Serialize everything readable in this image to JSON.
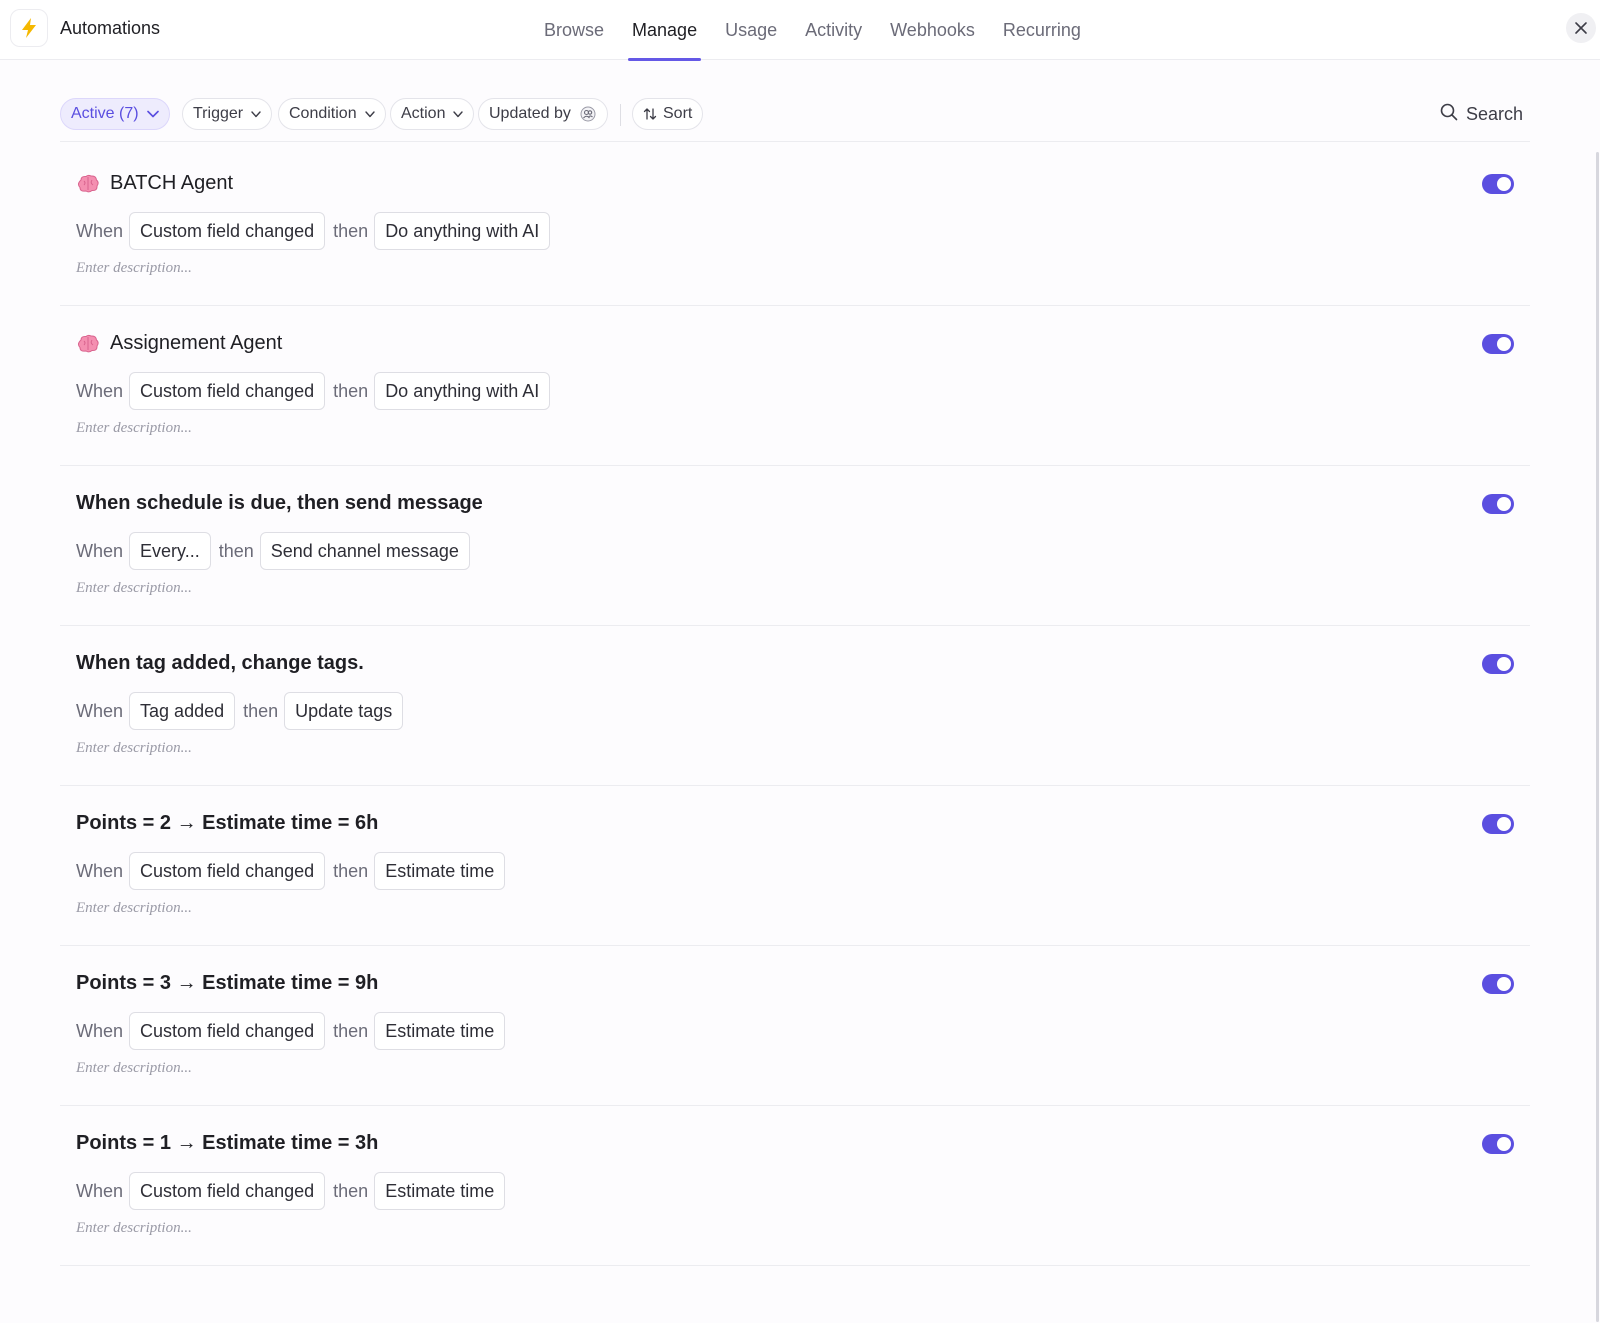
{
  "header": {
    "title": "Automations",
    "tabs": [
      {
        "label": "Browse"
      },
      {
        "label": "Manage"
      },
      {
        "label": "Usage"
      },
      {
        "label": "Activity"
      },
      {
        "label": "Webhooks"
      },
      {
        "label": "Recurring"
      }
    ],
    "active_tab": "Manage"
  },
  "filters": {
    "active": "Active (7)",
    "trigger": "Trigger",
    "condition": "Condition",
    "action": "Action",
    "updated_by": "Updated by",
    "sort": "Sort",
    "search": "Search"
  },
  "colors": {
    "accent": "#5b4fe0",
    "brand_bolt": "#f5b800"
  },
  "automations": [
    {
      "title": "BATCH Agent",
      "icon": "brain-icon",
      "when": "When",
      "trigger": "Custom field changed",
      "then": "then",
      "action": "Do anything with AI",
      "description_placeholder": "Enter description...",
      "enabled": true
    },
    {
      "title": "Assignement Agent",
      "icon": "brain-icon",
      "when": "When",
      "trigger": "Custom field changed",
      "then": "then",
      "action": "Do anything with AI",
      "description_placeholder": "Enter description...",
      "enabled": true
    },
    {
      "title": "When schedule is due, then send message",
      "when": "When",
      "trigger": "Every...",
      "then": "then",
      "action": "Send channel message",
      "description_placeholder": "Enter description...",
      "enabled": true
    },
    {
      "title": "When tag added, change tags.",
      "when": "When",
      "trigger": "Tag added",
      "then": "then",
      "action": "Update tags",
      "description_placeholder": "Enter description...",
      "enabled": true
    },
    {
      "title": "Points = 2 → Estimate time = 6h",
      "when": "When",
      "trigger": "Custom field changed",
      "then": "then",
      "action": "Estimate time",
      "description_placeholder": "Enter description...",
      "enabled": true
    },
    {
      "title": "Points = 3 → Estimate time = 9h",
      "when": "When",
      "trigger": "Custom field changed",
      "then": "then",
      "action": "Estimate time",
      "description_placeholder": "Enter description...",
      "enabled": true
    },
    {
      "title": "Points = 1 → Estimate time = 3h",
      "when": "When",
      "trigger": "Custom field changed",
      "then": "then",
      "action": "Estimate time",
      "description_placeholder": "Enter description...",
      "enabled": true
    }
  ]
}
